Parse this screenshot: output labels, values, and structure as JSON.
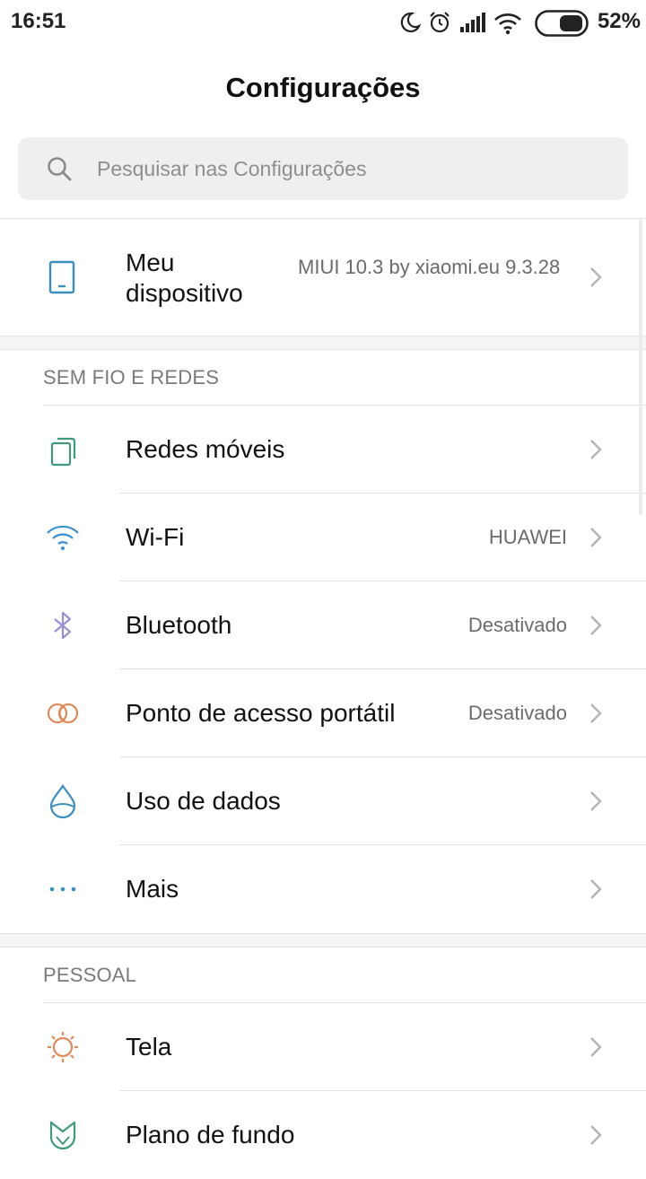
{
  "status_bar": {
    "time": "16:51",
    "battery": "52%"
  },
  "header": {
    "title": "Configurações"
  },
  "search": {
    "placeholder": "Pesquisar nas Configurações",
    "value": ""
  },
  "device": {
    "title": "Meu dispositivo",
    "version": "MIUI 10.3 by xiaomi.eu 9.3.28",
    "icon": "phone-icon"
  },
  "sections": [
    {
      "header": "SEM FIO E REDES",
      "items": [
        {
          "label": "Redes móveis",
          "value": "",
          "icon": "sim-card-icon",
          "color": "#3f9a7a"
        },
        {
          "label": "Wi-Fi",
          "value": "HUAWEI",
          "icon": "wifi-icon",
          "color": "#3a8fd0"
        },
        {
          "label": "Bluetooth",
          "value": "Desativado",
          "icon": "bluetooth-icon",
          "color": "#9b8fd3"
        },
        {
          "label": "Ponto de acesso portátil",
          "value": "Desativado",
          "icon": "hotspot-icon",
          "color": "#e08a5c"
        },
        {
          "label": "Uso de dados",
          "value": "",
          "icon": "data-drop-icon",
          "color": "#3a8fc0"
        },
        {
          "label": "Mais",
          "value": "",
          "icon": "more-dots-icon",
          "color": "#3a8fc0"
        }
      ]
    },
    {
      "header": "PESSOAL",
      "items": [
        {
          "label": "Tela",
          "value": "",
          "icon": "sun-icon",
          "color": "#e08a5c"
        },
        {
          "label": "Plano de fundo",
          "value": "",
          "icon": "wallpaper-tulip-icon",
          "color": "#3f9a7a"
        }
      ]
    }
  ]
}
